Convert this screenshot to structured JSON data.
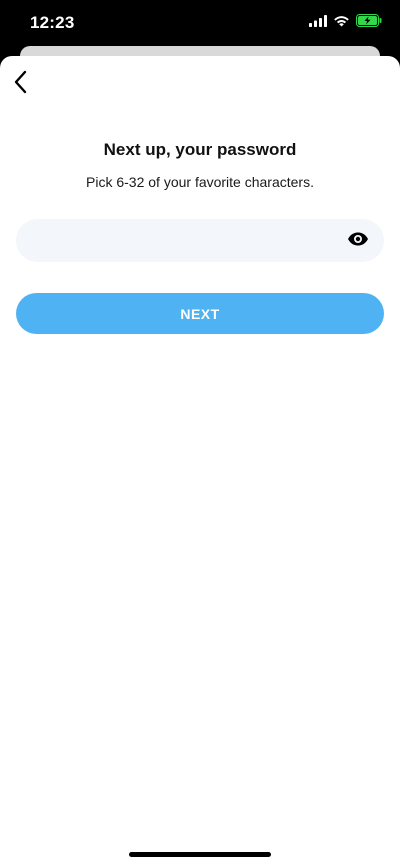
{
  "status_bar": {
    "time": "12:23",
    "icons": [
      "signal-icon",
      "wifi-icon",
      "battery-charging-icon"
    ],
    "battery_color": "#32d74b"
  },
  "header": {
    "back_icon": "chevron-left-icon"
  },
  "main": {
    "title": "Next up, your password",
    "subtitle": "Pick 6-32 of your favorite characters.",
    "password_field": {
      "value": "",
      "placeholder": "",
      "toggle_icon": "eye-icon"
    },
    "next_button": {
      "label": "NEXT",
      "color": "#4fb3f3"
    }
  }
}
